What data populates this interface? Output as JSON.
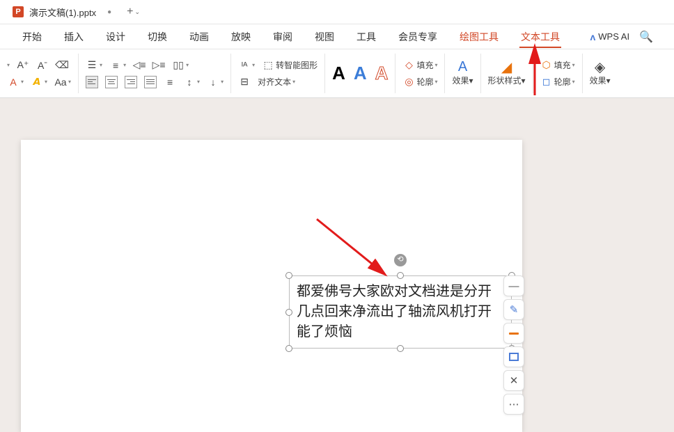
{
  "titlebar": {
    "tab_label": "演示文稿(1).pptx",
    "p_icon": "P",
    "close": "●",
    "add": "+",
    "add_caret": "⌄"
  },
  "menu": {
    "items": [
      "开始",
      "插入",
      "设计",
      "切换",
      "动画",
      "放映",
      "审阅",
      "视图",
      "工具",
      "会员专享",
      "绘图工具",
      "文本工具"
    ],
    "wps_ai_icon": "ᴧ",
    "wps_ai": "WPS AI",
    "search": "🔍"
  },
  "ribbon": {
    "g1": {
      "font_inc": "A⁺",
      "font_dec": "Aˉ",
      "clear": "⌫",
      "font_color": "A",
      "highlight": "𝘼",
      "_caret": "▾",
      "change_case": "Aa"
    },
    "g2": {
      "bullets": "☰",
      "numbering": "≡",
      "indent_dec": "◁≡",
      "indent_inc": "▷≡",
      "col": "▯▯",
      "align_l": "",
      "align_c": "",
      "align_r": "",
      "align_j": "",
      "dist": "≡",
      "ls": "↕",
      "dir": "↓"
    },
    "g3": {
      "text_dir_icon": "⟶",
      "text_dir": "ᴵᴬ",
      "text_dir_caret": "▾",
      "convert_smart": "转智能图形",
      "align_text": "对齐文本",
      "align_text_caret": "▾"
    },
    "g4": {
      "a1": "A",
      "a2": "A",
      "a3": "A"
    },
    "g5": {
      "fill_icon": "◇",
      "fill": "填充",
      "outline_icon": "◎",
      "outline": "轮廓",
      "effects_icon": "A",
      "effects": "效果",
      "caret": "▾"
    },
    "g6": {
      "shape_style_icon": "◢",
      "shape_style": "形状样式",
      "caret": "▾"
    },
    "g7": {
      "fill_icon": "⬡",
      "fill": "填充",
      "outline_icon": "◻",
      "outline": "轮廓",
      "effects_icon": "◈",
      "effects": "效果",
      "caret": "▾"
    }
  },
  "textbox": {
    "content": "都爱佛号大家欧对文档进是分开几点回来净流出了轴流风机打开能了烦恼",
    "rotate": "⟲"
  },
  "float": {
    "minus": "—",
    "pen": "✎",
    "magic": "✕"
  }
}
